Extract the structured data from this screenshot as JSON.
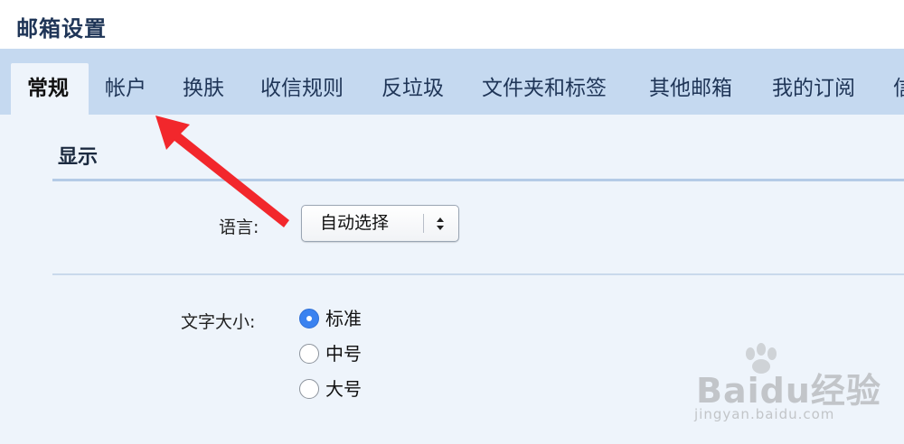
{
  "page": {
    "title": "邮箱设置"
  },
  "tabs": [
    {
      "label": "常规",
      "active": true
    },
    {
      "label": "帐户",
      "active": false
    },
    {
      "label": "换肤",
      "active": false
    },
    {
      "label": "收信规则",
      "active": false
    },
    {
      "label": "反垃圾",
      "active": false
    },
    {
      "label": "文件夹和标签",
      "active": false
    },
    {
      "label": "其他邮箱",
      "active": false
    },
    {
      "label": "我的订阅",
      "active": false
    },
    {
      "label": "信",
      "active": false
    }
  ],
  "section": {
    "title": "显示"
  },
  "language": {
    "label": "语言:",
    "selected": "自动选择"
  },
  "font_size": {
    "label": "文字大小:",
    "options": [
      {
        "label": "标准",
        "checked": true
      },
      {
        "label": "中号",
        "checked": false
      },
      {
        "label": "大号",
        "checked": false
      }
    ]
  },
  "annotation": {
    "arrow_color": "#f2272c"
  },
  "watermark": {
    "brand": "Baidu经验",
    "url": "jingyan.baidu.com"
  },
  "colors": {
    "tabbar": "#c5d9f0",
    "content": "#eef4fb",
    "radio_checked": "#3a82f0"
  }
}
